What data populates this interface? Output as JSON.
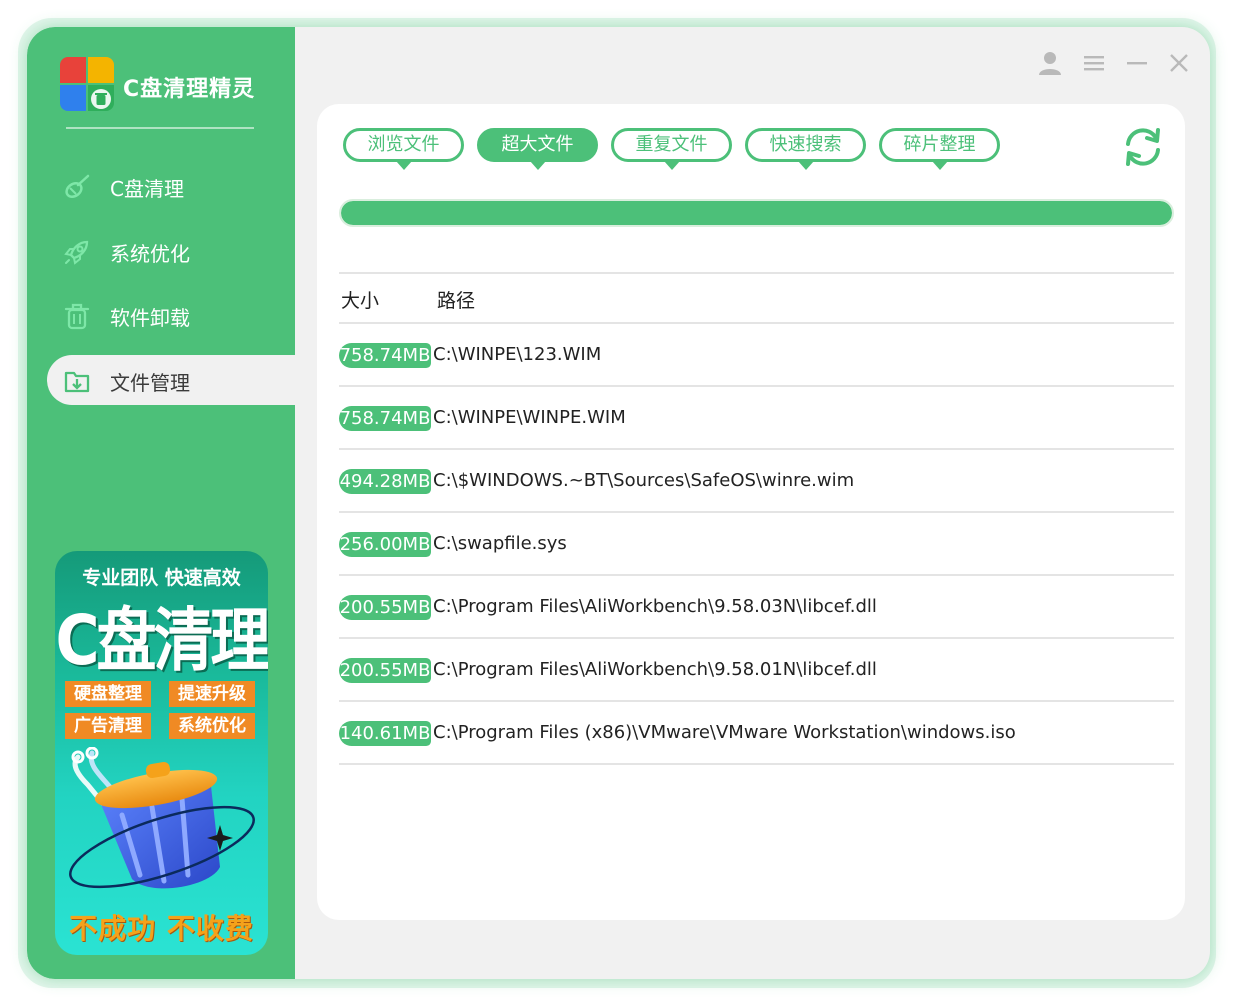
{
  "app": {
    "title": "C盘清理精灵"
  },
  "colors": {
    "accent": "#4cc079",
    "logo_red": "#e8423a",
    "logo_yellow": "#f4b400",
    "logo_blue": "#2f80ed",
    "logo_green": "#2fae5b"
  },
  "sidebar": {
    "items": [
      {
        "label": "C盘清理",
        "icon": "broom-icon"
      },
      {
        "label": "系统优化",
        "icon": "rocket-icon"
      },
      {
        "label": "软件卸载",
        "icon": "trash-icon"
      },
      {
        "label": "文件管理",
        "icon": "folder-download-icon",
        "active": true
      }
    ]
  },
  "promo": {
    "top": "专业团队  快速高效",
    "big": "C盘清理",
    "tags": [
      "硬盘整理",
      "提速升级",
      "广告清理",
      "系统优化"
    ],
    "bottom": "不成功 不收费",
    "icon": "trash-bin-icon"
  },
  "window_controls": [
    "user-icon",
    "menu-icon",
    "minimize-icon",
    "close-icon"
  ],
  "tabs": [
    {
      "label": "浏览文件"
    },
    {
      "label": "超大文件",
      "active": true
    },
    {
      "label": "重复文件"
    },
    {
      "label": "快速搜索"
    },
    {
      "label": "碎片整理"
    }
  ],
  "progress": {
    "percent": 100
  },
  "table": {
    "headers": {
      "size": "大小",
      "path": "路径"
    },
    "rows": [
      {
        "size": "758.74MB",
        "path": "C:\\WINPE\\123.WIM"
      },
      {
        "size": "758.74MB",
        "path": "C:\\WINPE\\WINPE.WIM"
      },
      {
        "size": "494.28MB",
        "path": "C:\\$WINDOWS.~BT\\Sources\\SafeOS\\winre.wim"
      },
      {
        "size": "256.00MB",
        "path": "C:\\swapfile.sys"
      },
      {
        "size": "200.55MB",
        "path": "C:\\Program Files\\AliWorkbench\\9.58.03N\\libcef.dll"
      },
      {
        "size": "200.55MB",
        "path": "C:\\Program Files\\AliWorkbench\\9.58.01N\\libcef.dll"
      },
      {
        "size": "140.61MB",
        "path": "C:\\Program Files (x86)\\VMware\\VMware Workstation\\windows.iso"
      }
    ]
  }
}
